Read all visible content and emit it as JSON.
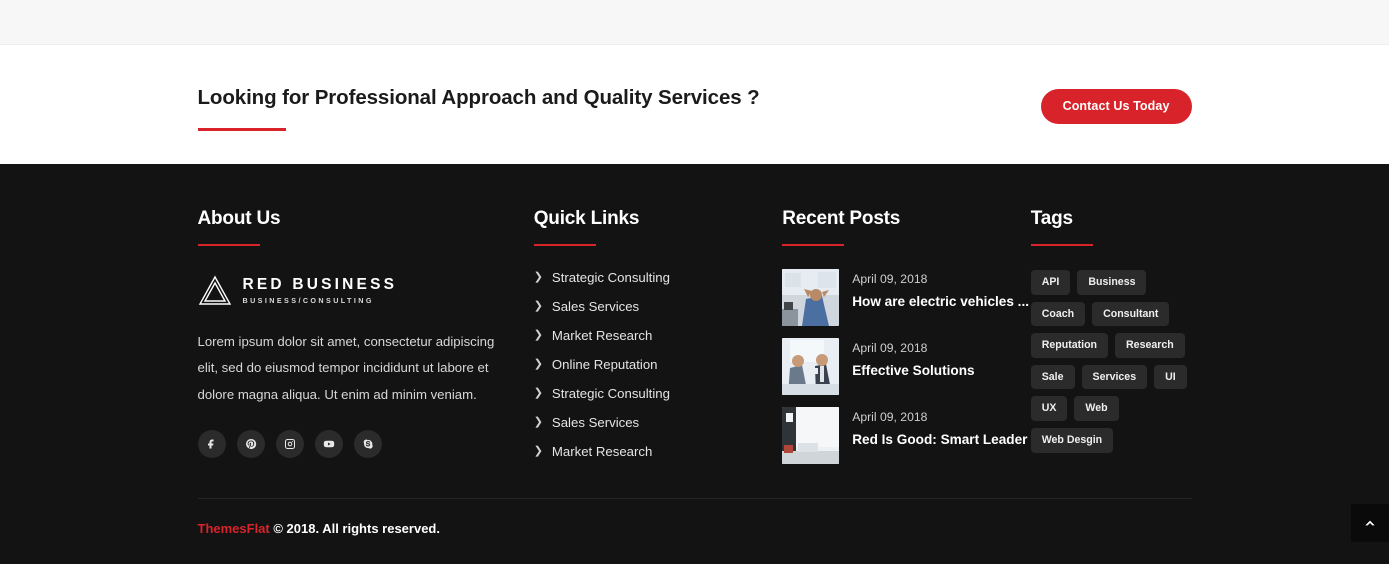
{
  "cta": {
    "title": "Looking for Professional Approach and Quality Services ?",
    "button_label": "Contact Us Today",
    "accent_color": "#d8232a"
  },
  "footer": {
    "background_color": "#131313",
    "about": {
      "title": "About Us",
      "logo_main": "RED BUSINESS",
      "logo_sub": "BUSINESS/CONSULTING",
      "description": "Lorem ipsum dolor sit amet, consectetur adipiscing elit, sed do eiusmod tempor incididunt ut labore et dolore magna aliqua. Ut enim ad minim veniam.",
      "socials": [
        {
          "name": "facebook-icon"
        },
        {
          "name": "pinterest-icon"
        },
        {
          "name": "instagram-icon"
        },
        {
          "name": "youtube-icon"
        },
        {
          "name": "skype-icon"
        }
      ]
    },
    "quick_links": {
      "title": "Quick Links",
      "items": [
        "Strategic Consulting",
        "Sales Services",
        "Market Research",
        "Online Reputation",
        "Strategic Consulting",
        "Sales Services",
        "Market Research"
      ]
    },
    "recent_posts": {
      "title": "Recent Posts",
      "items": [
        {
          "date": "April 09, 2018",
          "title": "How are electric vehicles ..."
        },
        {
          "date": "April 09, 2018",
          "title": "Effective Solutions"
        },
        {
          "date": "April 09, 2018",
          "title": "Red Is Good: Smart Leader"
        }
      ]
    },
    "tags": {
      "title": "Tags",
      "items": [
        "API",
        "Business",
        "Coach",
        "Consultant",
        "Reputation",
        "Research",
        "Sale",
        "Services",
        "UI",
        "UX",
        "Web",
        "Web Desgin"
      ]
    },
    "bottom": {
      "brand": "ThemesFlat",
      "copyright": "© 2018. All rights reserved."
    },
    "scroll_top_icon": "chevron-up-icon"
  }
}
